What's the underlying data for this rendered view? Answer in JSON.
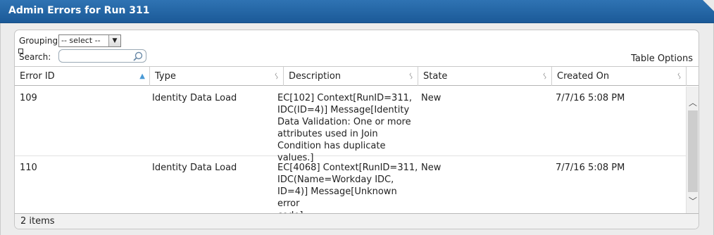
{
  "window": {
    "title": "Admin Errors for Run 311"
  },
  "toolbar": {
    "grouping_label": "Grouping:",
    "grouping_value": "-- select --",
    "search_label": "Search:",
    "search_value": "",
    "table_options": "Table Options"
  },
  "columns": [
    {
      "label": "Error ID",
      "sort": "ascending"
    },
    {
      "label": "Type",
      "sort": "none"
    },
    {
      "label": "Description",
      "sort": "none"
    },
    {
      "label": "State",
      "sort": "none"
    },
    {
      "label": "Created On",
      "sort": "none"
    }
  ],
  "rows": [
    {
      "error_id": "109",
      "type": "Identity Data Load",
      "description": [
        "EC[102] Context[RunID=311,",
        "IDC(ID=4)] Message[Identity",
        "Data Validation: One or more",
        "attributes used in Join",
        "Condition has duplicate values.]"
      ],
      "state": "New",
      "created_on": "7/7/16 5:08 PM"
    },
    {
      "error_id": "110",
      "type": "Identity Data Load",
      "description": [
        "EC[4068] Context[RunID=311,",
        "IDC(Name=Workday IDC,",
        "ID=4)] Message[Unknown error",
        "code]"
      ],
      "state": "New",
      "created_on": "7/7/16 5:08 PM"
    }
  ],
  "footer": {
    "count_text": "2 items"
  },
  "colors": {
    "title_bar": "#1f5f9e",
    "accent": "#4a9ad6"
  }
}
